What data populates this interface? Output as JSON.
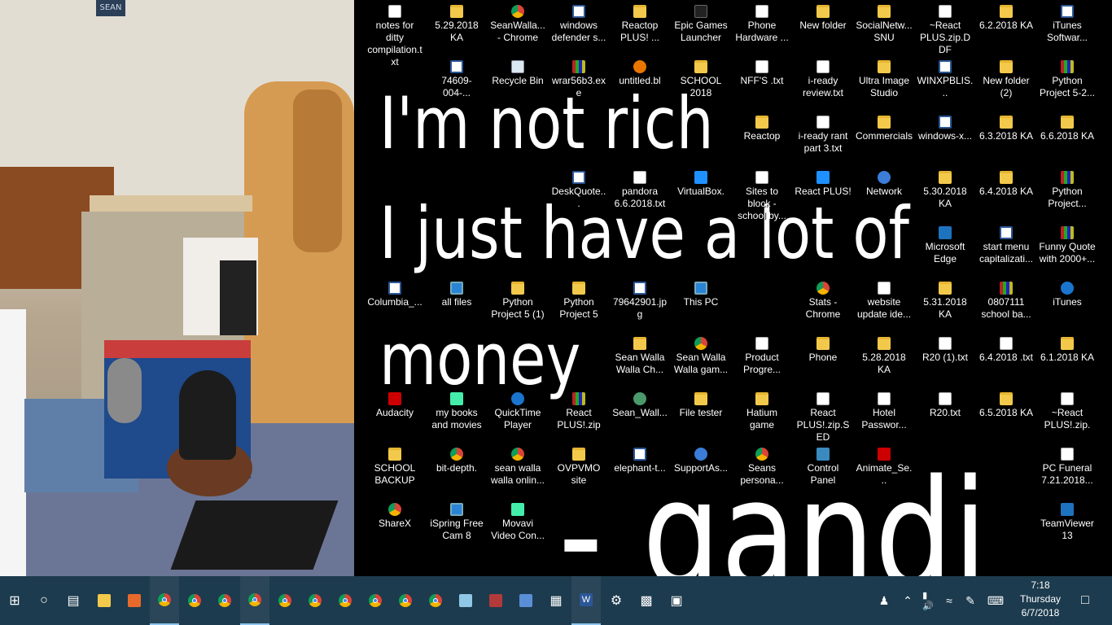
{
  "wallpaper": {
    "sign_text": "SEAN",
    "quote_lines": [
      "I'm not rich",
      "I just have a lot of",
      "money",
      "- gandi"
    ]
  },
  "icons": [
    {
      "label": "notes for ditty compilation.txt",
      "icon": "text-file-icon"
    },
    {
      "label": "5.29.2018 KA",
      "icon": "folder-icon"
    },
    {
      "label": "SeanWalla... - Chrome",
      "icon": "chrome-icon"
    },
    {
      "label": "windows defender s...",
      "icon": "word-doc-icon"
    },
    {
      "label": "Reactop PLUS! ...",
      "icon": "folder-icon"
    },
    {
      "label": "Epic Games Launcher",
      "icon": "epic-games-icon"
    },
    {
      "label": "Phone Hardware ...",
      "icon": "text-file-icon"
    },
    {
      "label": "New folder",
      "icon": "folder-icon"
    },
    {
      "label": "SocialNetw... SNU",
      "icon": "folder-icon"
    },
    {
      "label": "~React PLUS.zip.DDF",
      "icon": "text-file-icon"
    },
    {
      "label": "6.2.2018 KA",
      "icon": "folder-icon"
    },
    {
      "label": "iTunes Softwar...",
      "icon": "word-doc-icon"
    },
    {
      "label": "74609-004-...",
      "icon": "word-doc-icon"
    },
    {
      "label": "Recycle Bin",
      "icon": "recycle-bin-icon"
    },
    {
      "label": "wrar56b3.exe",
      "icon": "winrar-icon"
    },
    {
      "label": "untitled.bl",
      "icon": "blender-icon"
    },
    {
      "label": "SCHOOL 2018",
      "icon": "folder-icon"
    },
    {
      "label": "NFF'S .txt",
      "icon": "text-file-icon"
    },
    {
      "label": "i-ready review.txt",
      "icon": "text-file-icon"
    },
    {
      "label": "Ultra Image Studio",
      "icon": "folder-icon"
    },
    {
      "label": "WINXPBLIS...",
      "icon": "word-doc-icon"
    },
    {
      "label": "New folder (2)",
      "icon": "folder-icon"
    },
    {
      "label": "Python Project 5-2...",
      "icon": "winrar-icon"
    },
    {
      "label": "Reactop",
      "icon": "folder-icon"
    },
    {
      "label": "i-ready rant part 3.txt",
      "icon": "text-file-icon"
    },
    {
      "label": "Commercials",
      "icon": "folder-icon"
    },
    {
      "label": "windows-x...",
      "icon": "word-doc-icon"
    },
    {
      "label": "6.3.2018 KA",
      "icon": "folder-icon"
    },
    {
      "label": "6.6.2018 KA",
      "icon": "folder-icon"
    },
    {
      "label": "DeskQuote...",
      "icon": "word-doc-icon"
    },
    {
      "label": "pandora 6.6.2018.txt",
      "icon": "text-file-icon"
    },
    {
      "label": "VirtualBox.",
      "icon": "virtualbox-icon"
    },
    {
      "label": "Sites to block - school by...",
      "icon": "text-file-icon"
    },
    {
      "label": "React PLUS!",
      "icon": "app-icon"
    },
    {
      "label": "Network",
      "icon": "network-icon"
    },
    {
      "label": "5.30.2018 KA",
      "icon": "folder-icon"
    },
    {
      "label": "6.4.2018 KA",
      "icon": "folder-icon"
    },
    {
      "label": "Python Project...",
      "icon": "winrar-icon"
    },
    {
      "label": "Microsoft Edge",
      "icon": "edge-icon"
    },
    {
      "label": "start menu capitalizati...",
      "icon": "word-doc-icon"
    },
    {
      "label": "Funny Quote with 2000+...",
      "icon": "winrar-icon"
    },
    {
      "label": "Columbia_...",
      "icon": "word-doc-icon"
    },
    {
      "label": "all files",
      "icon": "monitor-icon"
    },
    {
      "label": "Python Project 5 (1)",
      "icon": "folder-icon"
    },
    {
      "label": "Python Project 5",
      "icon": "folder-icon"
    },
    {
      "label": "79642901.jpg",
      "icon": "word-doc-icon"
    },
    {
      "label": "This PC",
      "icon": "monitor-icon"
    },
    {
      "label": "",
      "icon": "blank-icon"
    },
    {
      "label": "Stats - Chrome",
      "icon": "chrome-icon"
    },
    {
      "label": "website update ide...",
      "icon": "text-file-icon"
    },
    {
      "label": "5.31.2018 KA",
      "icon": "folder-icon"
    },
    {
      "label": "0807111 school ba...",
      "icon": "winrar-icon"
    },
    {
      "label": "iTunes",
      "icon": "itunes-icon"
    },
    {
      "label": "Sean Walla Walla Ch...",
      "icon": "folder-icon"
    },
    {
      "label": "Sean Walla Walla gam...",
      "icon": "chrome-icon"
    },
    {
      "label": "Product Progre...",
      "icon": "text-file-icon"
    },
    {
      "label": "Phone",
      "icon": "folder-icon"
    },
    {
      "label": "5.28.2018 KA",
      "icon": "folder-icon"
    },
    {
      "label": "R20 (1).txt",
      "icon": "text-file-icon"
    },
    {
      "label": "6.4.2018 .txt",
      "icon": "text-file-icon"
    },
    {
      "label": "6.1.2018 KA",
      "icon": "folder-icon"
    },
    {
      "label": "Audacity",
      "icon": "audacity-icon"
    },
    {
      "label": "my books and movies",
      "icon": "books-icon"
    },
    {
      "label": "QuickTime Player",
      "icon": "quicktime-icon"
    },
    {
      "label": "React PLUS!.zip",
      "icon": "winrar-icon"
    },
    {
      "label": "Sean_Wall...",
      "icon": "person-icon"
    },
    {
      "label": "File tester",
      "icon": "folder-icon"
    },
    {
      "label": "Hatium game",
      "icon": "folder-icon"
    },
    {
      "label": "React PLUS!.zip.SED",
      "icon": "text-file-icon"
    },
    {
      "label": "Hotel Passwor...",
      "icon": "text-file-icon"
    },
    {
      "label": "R20.txt",
      "icon": "text-file-icon"
    },
    {
      "label": "6.5.2018 KA",
      "icon": "folder-icon"
    },
    {
      "label": "~React PLUS!.zip.",
      "icon": "text-file-icon"
    },
    {
      "label": "SCHOOL BACKUP",
      "icon": "folder-icon"
    },
    {
      "label": "bit-depth.",
      "icon": "chrome-icon"
    },
    {
      "label": "sean walla walla onlin...",
      "icon": "chrome-icon"
    },
    {
      "label": "OVPVMO site",
      "icon": "folder-icon"
    },
    {
      "label": "elephant-t...",
      "icon": "word-doc-icon"
    },
    {
      "label": "SupportAs...",
      "icon": "support-icon"
    },
    {
      "label": "Seans persona...",
      "icon": "chrome-icon"
    },
    {
      "label": "Control Panel",
      "icon": "control-panel-icon"
    },
    {
      "label": "Animate_Se...",
      "icon": "animate-icon"
    },
    {
      "label": "PC Funeral 7.21.2018...",
      "icon": "text-file-icon"
    },
    {
      "label": "ShareX",
      "icon": "sharex-icon"
    },
    {
      "label": "iSpring Free Cam 8",
      "icon": "ispring-icon"
    },
    {
      "label": "Movavi Video Con...",
      "icon": "movavi-icon"
    },
    {
      "label": "TeamViewer 13",
      "icon": "teamviewer-icon"
    }
  ],
  "taskbar": {
    "items": [
      {
        "icon": "windows-start-icon"
      },
      {
        "icon": "cortana-search-icon"
      },
      {
        "icon": "task-view-icon"
      },
      {
        "icon": "file-explorer-icon"
      },
      {
        "icon": "paint-app-icon"
      },
      {
        "icon": "chrome-icon"
      },
      {
        "icon": "chrome-icon"
      },
      {
        "icon": "chrome-icon"
      },
      {
        "icon": "chrome-icon"
      },
      {
        "icon": "chrome-icon"
      },
      {
        "icon": "chrome-icon"
      },
      {
        "icon": "chrome-icon"
      },
      {
        "icon": "chrome-icon"
      },
      {
        "icon": "chrome-icon"
      },
      {
        "icon": "chrome-icon"
      },
      {
        "icon": "notepad-icon"
      },
      {
        "icon": "winrar-icon"
      },
      {
        "icon": "paint-icon"
      },
      {
        "icon": "calculator-icon"
      },
      {
        "icon": "word-icon"
      },
      {
        "icon": "settings-gear-icon"
      },
      {
        "icon": "command-prompt-icon"
      },
      {
        "icon": "photos-icon"
      }
    ],
    "tray": {
      "time": "7:18",
      "day": "Thursday",
      "date": "6/7/2018"
    }
  }
}
